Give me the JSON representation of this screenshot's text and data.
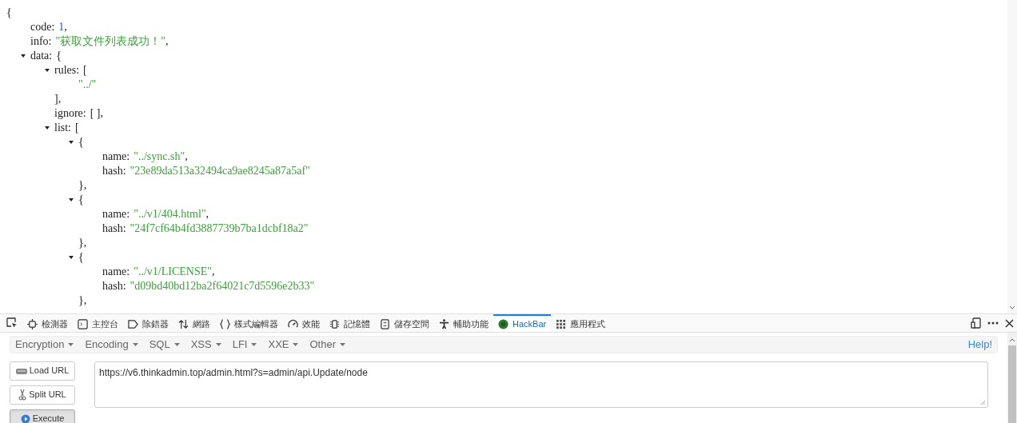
{
  "viewer": {
    "open": "{",
    "children": [
      {
        "kind": "number",
        "key": "code:",
        "value": "1",
        "tail": ","
      },
      {
        "kind": "string",
        "key": "info:",
        "value": "\"获取文件列表成功！\"",
        "tail": ","
      },
      {
        "kind": "object",
        "key": "data:",
        "open": "{",
        "expanded": true,
        "children": [
          {
            "kind": "array",
            "key": "rules:",
            "open": "[",
            "expanded": true,
            "close": "],",
            "children": [
              {
                "kind": "string",
                "value": "\"../\""
              }
            ]
          },
          {
            "kind": "plain",
            "key": "ignore:",
            "value": "[ ],"
          },
          {
            "kind": "array",
            "key": "list:",
            "open": "[",
            "expanded": true,
            "children": [
              {
                "kind": "object",
                "open": "{",
                "expanded": true,
                "close": "},",
                "children": [
                  {
                    "kind": "string",
                    "key": "name:",
                    "value": "\"../sync.sh\"",
                    "tail": ","
                  },
                  {
                    "kind": "string",
                    "key": "hash:",
                    "value": "\"23e89da513a32494ca9ae8245a87a5af\""
                  }
                ]
              },
              {
                "kind": "object",
                "open": "{",
                "expanded": true,
                "close": "},",
                "children": [
                  {
                    "kind": "string",
                    "key": "name:",
                    "value": "\"../v1/404.html\"",
                    "tail": ","
                  },
                  {
                    "kind": "string",
                    "key": "hash:",
                    "value": "\"24f7cf64b4fd3887739b7ba1dcbf18a2\""
                  }
                ]
              },
              {
                "kind": "object",
                "open": "{",
                "expanded": true,
                "close": "},",
                "children": [
                  {
                    "kind": "string",
                    "key": "name:",
                    "value": "\"../v1/LICENSE\"",
                    "tail": ","
                  },
                  {
                    "kind": "string",
                    "key": "hash:",
                    "value": "\"d09bd40bd12ba2f64021c7d5596e2b33\""
                  }
                ]
              }
            ]
          }
        ]
      }
    ]
  },
  "devtools_tabs": [
    {
      "label": "檢測器",
      "selected": false
    },
    {
      "label": "主控台",
      "selected": false
    },
    {
      "label": "除錯器",
      "selected": false
    },
    {
      "label": "網路",
      "selected": false
    },
    {
      "label": "樣式編輯器",
      "selected": false
    },
    {
      "label": "效能",
      "selected": false
    },
    {
      "label": "記憶體",
      "selected": false
    },
    {
      "label": "儲存空間",
      "selected": false
    },
    {
      "label": "輔助功能",
      "selected": false
    },
    {
      "label": "HackBar",
      "selected": true
    },
    {
      "label": "應用程式",
      "selected": false
    }
  ],
  "hackbar": {
    "menus": [
      "Encryption",
      "Encoding",
      "SQL",
      "XSS",
      "LFI",
      "XXE",
      "Other"
    ],
    "help": "Help!",
    "buttons": [
      {
        "label": "Load URL",
        "pressed": false
      },
      {
        "label": "Split URL",
        "pressed": false
      },
      {
        "label": "Execute",
        "pressed": true
      }
    ],
    "url": "https://v6.thinkadmin.top/admin.html?s=admin/api.Update/node"
  }
}
